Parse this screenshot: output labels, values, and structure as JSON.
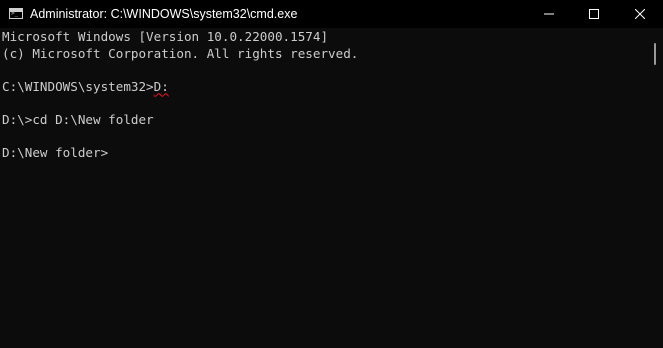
{
  "window": {
    "title": "Administrator: C:\\WINDOWS\\system32\\cmd.exe",
    "app_icon": "cmd-icon",
    "buttons": {
      "minimize_icon": "minimize-icon",
      "maximize_icon": "maximize-icon",
      "close_icon": "close-icon"
    }
  },
  "console": {
    "lines": [
      "Microsoft Windows [Version 10.0.22000.1574]",
      "(c) Microsoft Corporation. All rights reserved.",
      "",
      "C:\\WINDOWS\\system32>",
      "",
      "D:\\>cd D:\\New folder",
      "",
      "D:\\New folder>"
    ],
    "underlined_command": "D:"
  },
  "colors": {
    "background": "#0c0c0c",
    "titlebar": "#000000",
    "text": "#cccccc",
    "squiggle": "#e81123"
  }
}
